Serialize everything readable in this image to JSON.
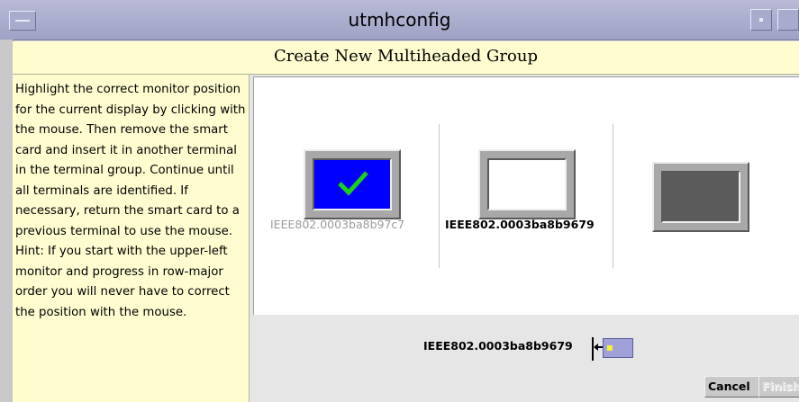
{
  "window": {
    "title": "utmhconfig"
  },
  "heading": "Create New Multiheaded Group",
  "instructions": "Highlight the correct monitor position for the current display by clicking with the mouse.  Then remove the smart card and insert it in another terminal in the terminal group.  Continue until all terminals are identified.  If necessary, return the smart card to a previous terminal to use the mouse.  Hint:  If you start with the upper-left monitor and progress in row-major order you will never have to correct the position with the mouse.",
  "monitors": [
    {
      "label": "IEEE802.0003ba8b97c7",
      "state": "identified",
      "icon": "checkmark-icon"
    },
    {
      "label": "IEEE802.0003ba8b9679",
      "state": "current",
      "icon": ""
    },
    {
      "label": "",
      "state": "unassigned",
      "icon": ""
    }
  ],
  "current_terminal": {
    "label": "IEEE802.0003ba8b9679",
    "icon": "smart-card-icon"
  },
  "buttons": {
    "cancel": "Cancel",
    "finish": "Finish"
  },
  "colors": {
    "title_bar": "#a9abcd",
    "panel_bg": "#fffdd0",
    "identified_screen": "#0000ff",
    "check": "#19d219",
    "current_screen": "#ffffff",
    "unassigned_screen": "#5b5b5b"
  }
}
